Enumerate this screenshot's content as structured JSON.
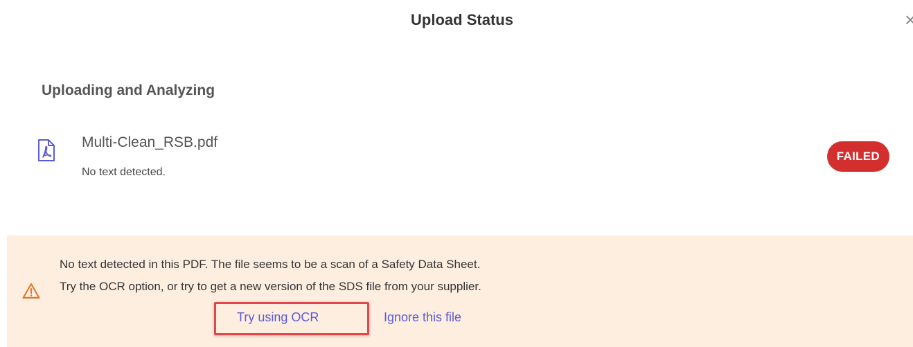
{
  "dialog": {
    "title": "Upload Status",
    "close_glyph": "×"
  },
  "section": {
    "heading": "Uploading and Analyzing"
  },
  "file": {
    "icon": "pdf-file-icon",
    "name": "Multi-Clean_RSB.pdf",
    "message": "No text detected.",
    "status": "FAILED"
  },
  "warning": {
    "icon": "warning-triangle-icon",
    "line1": "No text detected in this PDF. The file seems to be a scan of a Safety Data Sheet.",
    "line2": "Try the OCR option, or try to get a new version of the SDS file from your supplier.",
    "ocr_link": "Try using OCR",
    "ignore_link": "Ignore this file"
  },
  "colors": {
    "accent_link": "#5b5bd6",
    "status_failed": "#d32f2f",
    "warning_bg": "#fdeee0",
    "warning_icon": "#e07a2a",
    "highlight": "#e0484b"
  }
}
